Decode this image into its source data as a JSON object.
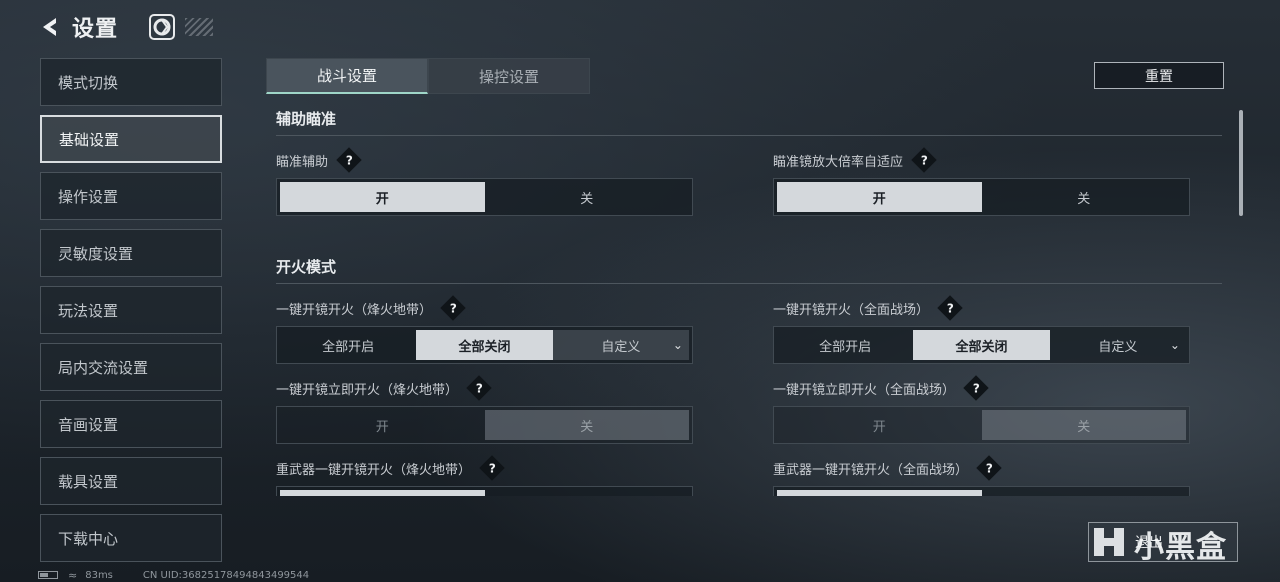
{
  "header": {
    "title": "设置"
  },
  "sidebar": {
    "items": [
      {
        "label": "模式切换"
      },
      {
        "label": "基础设置"
      },
      {
        "label": "操作设置"
      },
      {
        "label": "灵敏度设置"
      },
      {
        "label": "玩法设置"
      },
      {
        "label": "局内交流设置"
      },
      {
        "label": "音画设置"
      },
      {
        "label": "载具设置"
      },
      {
        "label": "下载中心"
      }
    ],
    "active_index": 1
  },
  "tabs": [
    {
      "label": "战斗设置",
      "active": true
    },
    {
      "label": "操控设置",
      "active": false
    }
  ],
  "reset_label": "重置",
  "sections": {
    "aim_assist": {
      "title": "辅助瞄准",
      "left": {
        "label": "瞄准辅助",
        "options": [
          "开",
          "关"
        ],
        "selected": "开"
      },
      "right": {
        "label": "瞄准镜放大倍率自适应",
        "options": [
          "开",
          "关"
        ],
        "selected": "开"
      }
    },
    "fire_mode": {
      "title": "开火模式",
      "row1": {
        "left": {
          "label": "一键开镜开火（烽火地带）",
          "options": [
            "全部开启",
            "全部关闭",
            "自定义"
          ],
          "selected": "全部关闭"
        },
        "right": {
          "label": "一键开镜开火（全面战场）",
          "options": [
            "全部开启",
            "全部关闭",
            "自定义"
          ],
          "selected": "全部关闭"
        }
      },
      "row2": {
        "left": {
          "label": "一键开镜立即开火（烽火地带）",
          "options": [
            "开",
            "关"
          ],
          "selected": "关"
        },
        "right": {
          "label": "一键开镜立即开火（全面战场）",
          "options": [
            "开",
            "关"
          ],
          "selected": "关"
        }
      },
      "row3": {
        "left": {
          "label": "重武器一键开镜开火（烽火地带）"
        },
        "right": {
          "label": "重武器一键开镜开火（全面战场）"
        }
      }
    }
  },
  "help_mark": "?",
  "status": {
    "ping": "83ms",
    "uid": "CN UID:36825178494843499544"
  },
  "exit_label": "退出",
  "watermark": "小黑盒",
  "colors": {
    "accent": "#9fd6c8",
    "selected": "#d4d8dc"
  }
}
